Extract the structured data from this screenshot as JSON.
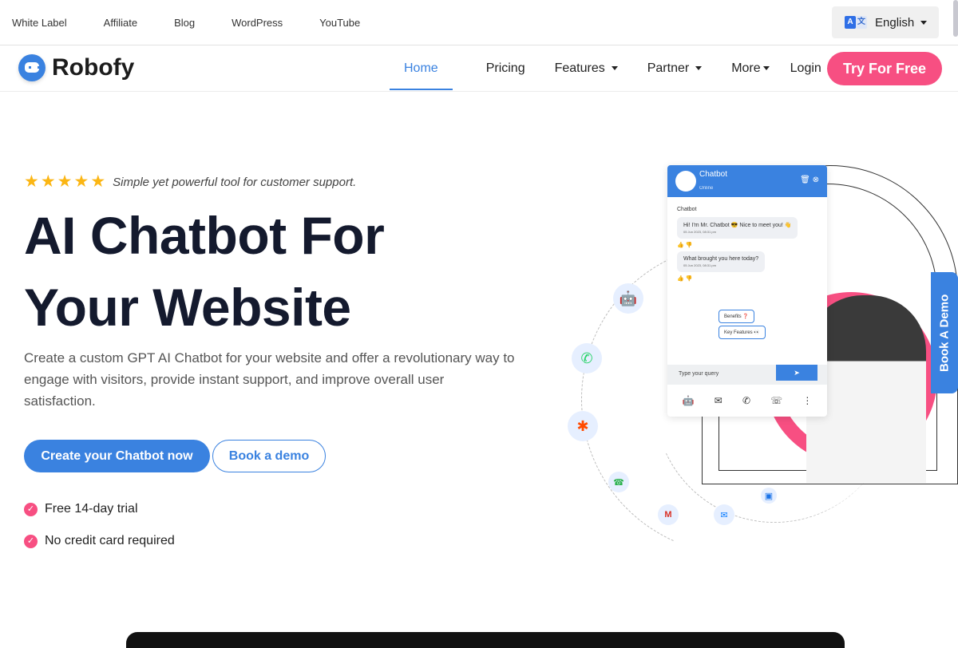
{
  "topbar": {
    "links": [
      "White Label",
      "Affiliate",
      "Blog",
      "WordPress",
      "YouTube"
    ],
    "language": {
      "label": "English",
      "icon": "translate-icon"
    }
  },
  "nav": {
    "brand": "Robofy",
    "items": [
      {
        "label": "Home",
        "active": true
      },
      {
        "label": "Pricing"
      },
      {
        "label": "Features",
        "dropdown": true
      },
      {
        "label": "Partner",
        "dropdown": true
      },
      {
        "label": "More",
        "dropdown": true
      },
      {
        "label": "Login"
      }
    ],
    "cta": "Try For Free"
  },
  "hero": {
    "rating_stars": 5,
    "tagline": "Simple yet powerful tool for customer support.",
    "title_line1": "AI Chatbot For",
    "title_line2": "Your Website",
    "description": "Create a custom GPT AI Chatbot for your website and offer a revolutionary way to engage with visitors, provide instant support, and improve overall user satisfaction.",
    "primary_button": "Create your Chatbot now",
    "secondary_button": "Book a demo",
    "checks": [
      "Free 14-day trial",
      "No credit card required"
    ]
  },
  "chat_widget": {
    "title": "Chatbot",
    "status": "Online",
    "sender": "Chatbot",
    "messages": [
      {
        "text": "Hi! I'm Mr. Chatbot 😎 Nice to meet you! 👋",
        "time": "05 Jun 2023, 08:31 pm"
      },
      {
        "text": "What brought you here today?",
        "time": "05 Jun 2023, 08:31 pm"
      }
    ],
    "quick_replies": [
      "Benefits ❓",
      "Key Features 👀"
    ],
    "input_placeholder": "Type your query"
  },
  "integrations": [
    "chatbot",
    "whatsapp",
    "zapier",
    "call",
    "gmail",
    "messenger",
    "calendar"
  ],
  "side_tab": "Book A Demo",
  "colors": {
    "primary": "#3a82e0",
    "accent": "#f74f82",
    "star": "#fbb614"
  }
}
